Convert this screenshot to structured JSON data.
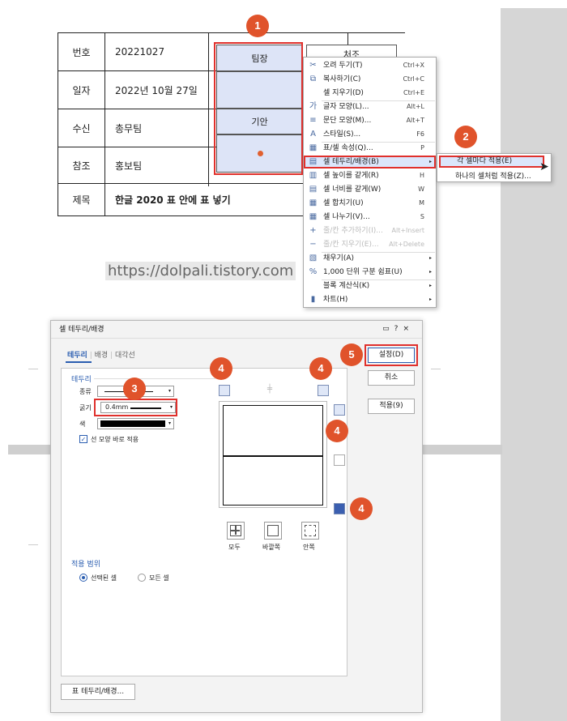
{
  "document": {
    "rows": [
      {
        "label": "번호",
        "value": "20221027"
      },
      {
        "label": "일자",
        "value": "2022년 10월 27일"
      },
      {
        "label": "수신",
        "value": "총무팀"
      },
      {
        "label": "참조",
        "value": "홍보팀"
      },
      {
        "label": "제목",
        "value": "한글 2020 표 안에 표 넣기"
      }
    ],
    "approval": [
      "팀장",
      "기안"
    ],
    "approval_right": "처조",
    "watermark": "https://dolpali.tistory.com"
  },
  "badges": [
    "1",
    "2",
    "3",
    "4",
    "4",
    "4",
    "4",
    "5"
  ],
  "context_menu": {
    "items": [
      {
        "icon": "scissors-icon",
        "glyph": "✂",
        "label": "오려 두기(T)",
        "shortcut": "Ctrl+X"
      },
      {
        "icon": "copy-icon",
        "glyph": "⧉",
        "label": "복사하기(C)",
        "shortcut": "Ctrl+C"
      },
      {
        "icon": "",
        "glyph": "",
        "label": "셀 지우기(D)",
        "shortcut": "Ctrl+E"
      },
      {
        "icon": "font-shape-icon",
        "glyph": "가",
        "label": "글자 모양(L)...",
        "shortcut": "Alt+L"
      },
      {
        "icon": "paragraph-icon",
        "glyph": "≡",
        "label": "문단 모양(M)...",
        "shortcut": "Alt+T"
      },
      {
        "icon": "style-icon",
        "glyph": "A",
        "label": "스타일(S)...",
        "shortcut": "F6"
      },
      {
        "icon": "table-props-icon",
        "glyph": "▦",
        "label": "표/셀 속성(Q)...",
        "shortcut": "P"
      },
      {
        "icon": "cell-border-icon",
        "glyph": "▤",
        "label": "셀 테두리/배경(B)",
        "shortcut": ""
      },
      {
        "icon": "equal-height-icon",
        "glyph": "▥",
        "label": "셀 높이를 같게(R)",
        "shortcut": "H"
      },
      {
        "icon": "equal-width-icon",
        "glyph": "▤",
        "label": "셀 너비를 같게(W)",
        "shortcut": "W"
      },
      {
        "icon": "merge-icon",
        "glyph": "▦",
        "label": "셀 합치기(U)",
        "shortcut": "M"
      },
      {
        "icon": "split-icon",
        "glyph": "▦",
        "label": "셀 나누기(V)...",
        "shortcut": "S"
      },
      {
        "icon": "add-row-icon",
        "glyph": "+",
        "label": "줄/칸 추가하기(I)...",
        "shortcut": "Alt+Insert"
      },
      {
        "icon": "delete-row-icon",
        "glyph": "−",
        "label": "줄/칸 지우기(E)...",
        "shortcut": "Alt+Delete"
      },
      {
        "icon": "fill-icon",
        "glyph": "▧",
        "label": "채우기(A)",
        "shortcut": ""
      },
      {
        "icon": "thousand-sep-icon",
        "glyph": "%",
        "label": "1,000 단위 구분 쉼표(U)",
        "shortcut": ""
      },
      {
        "icon": "",
        "glyph": "",
        "label": "블록 계산식(K)",
        "shortcut": ""
      },
      {
        "icon": "chart-icon",
        "glyph": "▮",
        "label": "차트(H)",
        "shortcut": ""
      }
    ],
    "submenu": [
      "각 셀마다 적용(E)",
      "하나의 셀처럼 적용(Z)..."
    ]
  },
  "dialog": {
    "title": "셀 테두리/배경",
    "title_icons": [
      "▭",
      "?",
      "×"
    ],
    "tabs": [
      "테두리",
      "배경",
      "대각선"
    ],
    "section_border": "테두리",
    "type_label": "종류",
    "thickness_label": "굵기",
    "thickness_value": "0.4mm",
    "color_label": "색",
    "apply_line_now": "선 모양 바로 적용",
    "preset_labels": [
      "모두",
      "바깥쪽",
      "안쪽"
    ],
    "scope_title": "적용 범위",
    "scope_options": [
      "선택된 셀",
      "모든 셀"
    ],
    "table_border_button": "표 테두리/배경...",
    "buttons": {
      "ok": "설정(D)",
      "cancel": "취소",
      "apply": "적용(9)"
    }
  }
}
